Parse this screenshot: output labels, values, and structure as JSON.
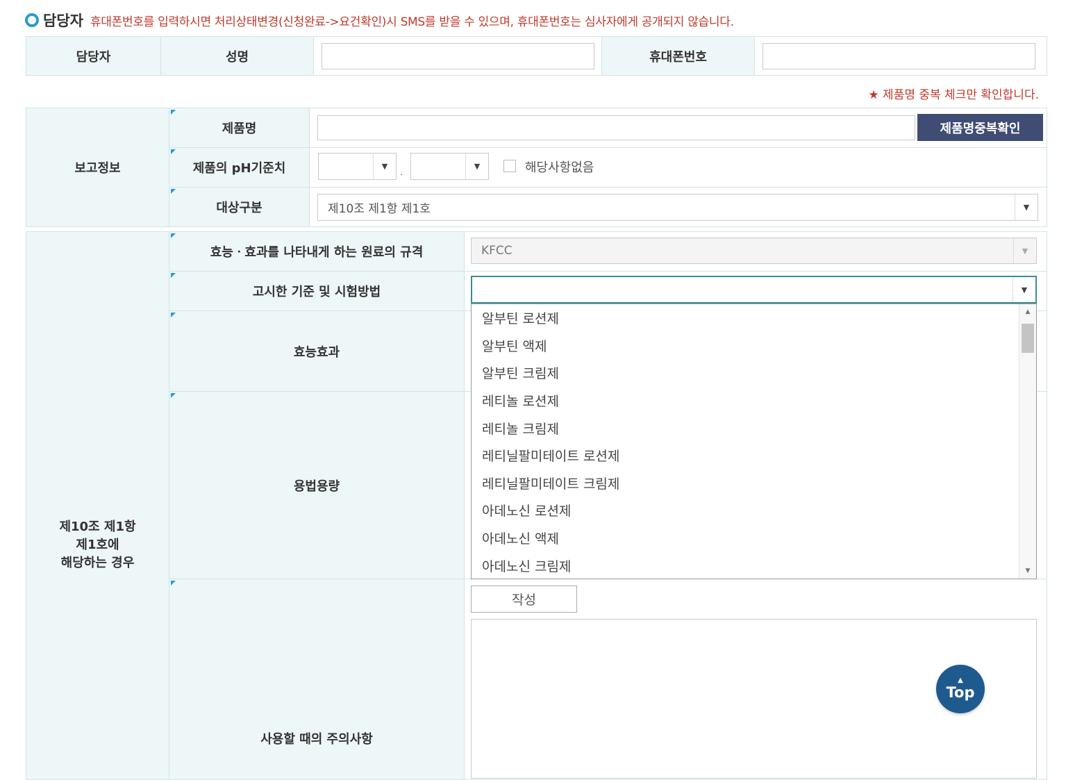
{
  "contact": {
    "title": "담당자",
    "notice": "휴대폰번호를 입력하시면 처리상태변경(신청완료->요건확인)시 SMS를 받을 수 있으며, 휴대폰번호는 심사자에게 공개되지 않습니다.",
    "row_label": "담당자",
    "name_label": "성명",
    "name_value": "",
    "phone_label": "휴대폰번호",
    "phone_value": ""
  },
  "duplicate_notice": "★ 제품명 중복 체크만 확인합니다.",
  "report_info": {
    "group_label": "보고정보",
    "product_name_label": "제품명",
    "product_name_value": "",
    "duplicate_button": "제품명중복확인",
    "ph_label": "제품의 pH기준치",
    "ph_min": "",
    "ph_separator": ".",
    "ph_max": "",
    "not_applicable_label": "해당사항없음",
    "target_label": "대상구분",
    "target_value": "제10조 제1항 제1호"
  },
  "article_section": {
    "group_label_line1": "제10조 제1항",
    "group_label_line2": "제1호에",
    "group_label_line3": "해당하는 경우",
    "raw_material_label": "효능ㆍ효과를 나타내게 하는 원료의 규격",
    "raw_material_value": "KFCC",
    "standard_label": "고시한 기준 및 시험방법",
    "standard_value": "",
    "efficacy_label": "효능효과",
    "dosage_label": "용법용량",
    "caution_label": "사용할 때의 주의사항",
    "write_button": "작성"
  },
  "dropdown_options": [
    "알부틴 로션제",
    "알부틴 액제",
    "알부틴 크림제",
    "레티놀 로션제",
    "레티놀 크림제",
    "레티닐팔미테이트 로션제",
    "레티닐팔미테이트 크림제",
    "아데노신 로션제",
    "아데노신 액제",
    "아데노신 크림제"
  ],
  "top_button": "Top",
  "icons": {
    "section_marker": "circle-icon",
    "select_arrow": "caret-down-icon",
    "scroll_up": "caret-up-icon",
    "scroll_down": "caret-down-icon"
  },
  "colors": {
    "label_bg": "#eef7f8",
    "notice_red": "#c0392b",
    "accent_blue": "#2a9bd2",
    "button_navy": "#3f4c73",
    "top_button_blue": "#1f5a8f",
    "focus_teal": "#3b8c95"
  }
}
